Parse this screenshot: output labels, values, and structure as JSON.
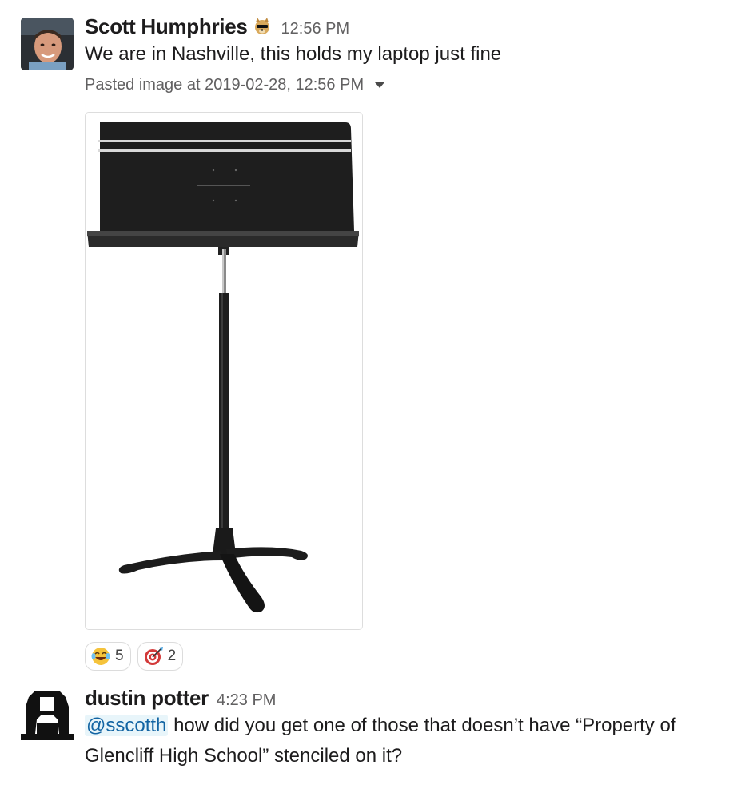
{
  "messages": [
    {
      "author": "Scott Humphries",
      "status_emoji": "sunglasses-dog-icon",
      "timestamp": "12:56 PM",
      "text": "We are in Nashville, this holds my laptop just fine",
      "attachment": {
        "name": "Pasted image at 2019-02-28, 12:56 PM",
        "image_description": "music-stand"
      },
      "reactions": [
        {
          "emoji": "joy-icon",
          "count": "5"
        },
        {
          "emoji": "dart-icon",
          "count": "2"
        }
      ]
    },
    {
      "author": "dustin potter",
      "timestamp": "4:23 PM",
      "mention": "@sscotth",
      "text_line1": " how did you get one of those that doesn’t have “Property of",
      "text_line2": "Glencliff High School” stenciled on it?"
    }
  ],
  "colors": {
    "mention_bg": "#e8f5fa",
    "mention_fg": "#1264a3",
    "timestamp": "#616061",
    "text": "#1d1c1d"
  }
}
